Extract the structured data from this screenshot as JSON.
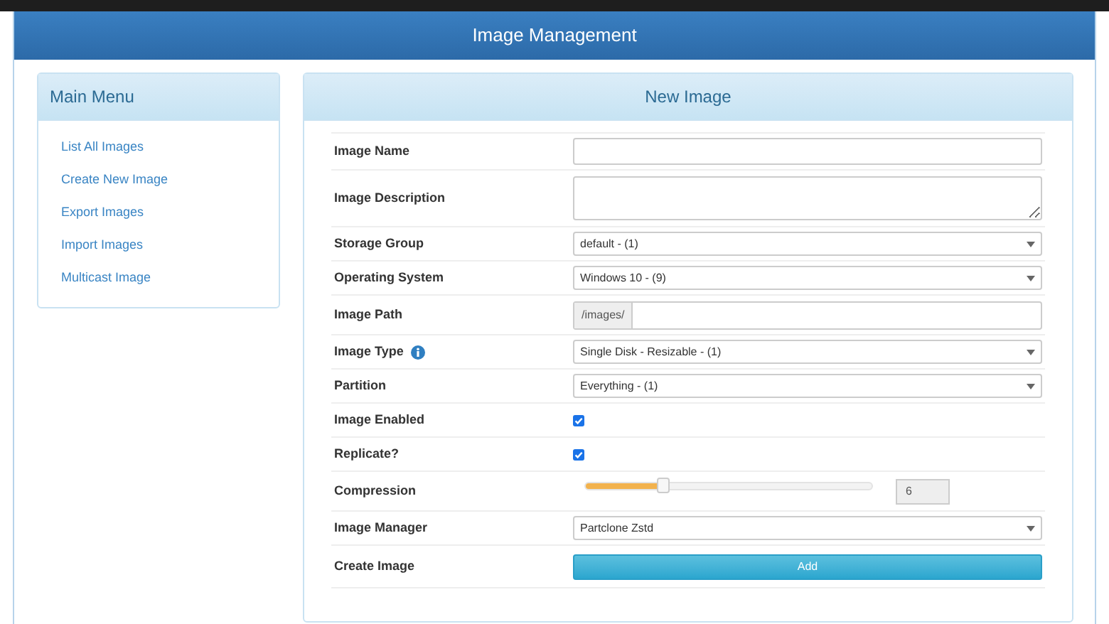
{
  "window": {
    "title": "Image Management"
  },
  "sidebar": {
    "title": "Main Menu",
    "items": [
      {
        "label": "List All Images"
      },
      {
        "label": "Create New Image"
      },
      {
        "label": "Export Images"
      },
      {
        "label": "Import Images"
      },
      {
        "label": "Multicast Image"
      }
    ]
  },
  "form": {
    "title": "New Image",
    "rows": [
      {
        "label": "Image Name",
        "kind": "text"
      },
      {
        "label": "Image Description",
        "kind": "textarea"
      },
      {
        "label": "Storage Group",
        "kind": "select",
        "value": "default - (1)"
      },
      {
        "label": "Operating System",
        "kind": "select",
        "value": "Windows 10 - (9)"
      },
      {
        "label": "Image Path",
        "kind": "prefix",
        "prefix": "/images/"
      },
      {
        "label": "Image Type",
        "kind": "select",
        "value": "Single Disk - Resizable - (1)",
        "info": true
      },
      {
        "label": "Partition",
        "kind": "select",
        "value": "Everything - (1)"
      },
      {
        "label": "Image Enabled",
        "kind": "checkbox",
        "checked": true
      },
      {
        "label": "Replicate?",
        "kind": "checkbox",
        "checked": true
      },
      {
        "label": "Compression",
        "kind": "slider",
        "level": 0.27,
        "value": "6"
      },
      {
        "label": "Image Manager",
        "kind": "select",
        "value": "Partclone Zstd"
      },
      {
        "label": "Create Image",
        "kind": "button",
        "value": "Add"
      }
    ]
  }
}
